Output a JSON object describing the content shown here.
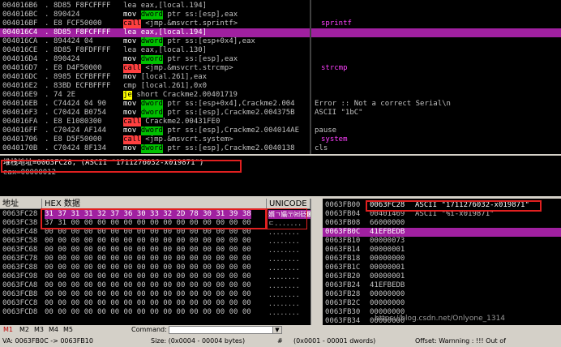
{
  "disasm": [
    {
      "addr": "004016B6",
      "dot": ".",
      "hex": "8D85 F8FCFFFF",
      "mn": "lea",
      "op": "eax,[local.194]",
      "comment": ""
    },
    {
      "addr": "004016BC",
      "dot": ".",
      "hex": "890424",
      "mn": "mov",
      "tag": "dword",
      "op": " ptr ss:[esp],eax",
      "comment": ""
    },
    {
      "addr": "004016BF",
      "dot": ".",
      "hex": "E8 FCF50000",
      "mn": "call",
      "op": "<jmp.&msvcrt.sprintf>",
      "comment": "sprintf"
    },
    {
      "addr": "004016C4",
      "dot": ".",
      "hex": "8D85 F8FCFFFF",
      "mn": "lea",
      "op": "eax,[local.194]",
      "comment": "",
      "selected": true
    },
    {
      "addr": "004016CA",
      "dot": ".",
      "hex": "894424 04",
      "mn": "mov",
      "tag": "dword",
      "op": " ptr ss:[esp+0x4],eax",
      "comment": ""
    },
    {
      "addr": "004016CE",
      "dot": ".",
      "hex": "8D85 F8FDFFFF",
      "mn": "lea",
      "op": "eax,[local.130]",
      "comment": ""
    },
    {
      "addr": "004016D4",
      "dot": ".",
      "hex": "890424",
      "mn": "mov",
      "tag": "dword",
      "op": " ptr ss:[esp],eax",
      "comment": ""
    },
    {
      "addr": "004016D7",
      "dot": ".",
      "hex": "E8 D4F50000",
      "mn": "call",
      "op": "<jmp.&msvcrt.strcmp>",
      "comment": "strcmp"
    },
    {
      "addr": "004016DC",
      "dot": ".",
      "hex": "8985 ECFBFFFF",
      "mn": "mov",
      "op": "[local.261],eax",
      "comment": ""
    },
    {
      "addr": "004016E2",
      "dot": ".",
      "hex": "83BD ECFBFFFF",
      "mn": "cmp",
      "op": "[local.261],0x0",
      "comment": ""
    },
    {
      "addr": "004016E9",
      "dot": ".",
      "hex": "74 2E",
      "mn": "je",
      "op": "short Crackme2.00401719",
      "comment": ""
    },
    {
      "addr": "004016EB",
      "dot": ".",
      "hex": "C74424 04 90",
      "mn": "mov",
      "tag": "dword",
      "op": " ptr ss:[esp+0x4],Crackme2.004",
      "comment": "Error :: Not a correct Serial\\n"
    },
    {
      "addr": "004016F3",
      "dot": ".",
      "hex": "C70424 B0754",
      "mn": "mov",
      "tag": "dword",
      "op": " ptr ss:[esp],Crackme2.004375B",
      "comment": "ASCII \"1bC\""
    },
    {
      "addr": "004016FA",
      "dot": ".",
      "hex": "E8 E1080300",
      "mn": "call",
      "op": "Crackme2.00431FE0",
      "comment": ""
    },
    {
      "addr": "004016FF",
      "dot": ".",
      "hex": "C70424 AF144",
      "mn": "mov",
      "tag": "dword",
      "op": " ptr ss:[esp],Crackme2.004014AE",
      "comment": "pause"
    },
    {
      "addr": "00401706",
      "dot": ".",
      "hex": "E8 D5F50000",
      "mn": "call",
      "op": "<jmp.&msvcrt.system>",
      "comment": "system"
    },
    {
      "addr": "0040170B",
      "dot": ".",
      "hex": "C70424 8F134",
      "mn": "mov",
      "tag": "dword",
      "op": " ptr ss:[esp],Crackme2.0040138",
      "comment": "cls"
    }
  ],
  "info": {
    "line1": "堆栈地址=0063FC28, (ASCII \"1711276032-x019871\")",
    "line2": "eax=00000012"
  },
  "dump": {
    "headers": {
      "addr": "地址",
      "hex": "HEX 数据",
      "unicode": "UNICODE"
    },
    "rows": [
      {
        "addr": "0063FC28",
        "hex": "31 37 31 31 32 37 36 30 33 32 2D 78 30 31 39 38",
        "uni": "㜱ㄱ㜲〶㈳砭㄰㠹"
      },
      {
        "addr": "0063FC38",
        "hex": "37 31 00 00 00 00 00 00 00 00 00 00 00 00 00 00",
        "uni": "ㄷ......."
      },
      {
        "addr": "0063FC48",
        "hex": "00 00 00 00 00 00 00 00 00 00 00 00 00 00 00 00",
        "uni": "........"
      },
      {
        "addr": "0063FC58",
        "hex": "00 00 00 00 00 00 00 00 00 00 00 00 00 00 00 00",
        "uni": "........"
      },
      {
        "addr": "0063FC68",
        "hex": "00 00 00 00 00 00 00 00 00 00 00 00 00 00 00 00",
        "uni": "........"
      },
      {
        "addr": "0063FC78",
        "hex": "00 00 00 00 00 00 00 00 00 00 00 00 00 00 00 00",
        "uni": "........"
      },
      {
        "addr": "0063FC88",
        "hex": "00 00 00 00 00 00 00 00 00 00 00 00 00 00 00 00",
        "uni": "........"
      },
      {
        "addr": "0063FC98",
        "hex": "00 00 00 00 00 00 00 00 00 00 00 00 00 00 00 00",
        "uni": "........"
      },
      {
        "addr": "0063FCA8",
        "hex": "00 00 00 00 00 00 00 00 00 00 00 00 00 00 00 00",
        "uni": "........"
      },
      {
        "addr": "0063FCB8",
        "hex": "00 00 00 00 00 00 00 00 00 00 00 00 00 00 00 00",
        "uni": "........"
      },
      {
        "addr": "0063FCC8",
        "hex": "00 00 00 00 00 00 00 00 00 00 00 00 00 00 00 00",
        "uni": "........"
      },
      {
        "addr": "0063FCD8",
        "hex": "00 00 00 00 00 00 00 00 00 00 00 00 00 00 00 00",
        "uni": "........"
      }
    ]
  },
  "stack": [
    {
      "addr": "0063FB00",
      "val": "0063FC28",
      "comment": "ASCII \"1711276032-x019871\""
    },
    {
      "addr": "0063FB04",
      "val": "00401469",
      "comment": "ASCII \"%i-x019871\""
    },
    {
      "addr": "0063FB08",
      "val": "66000000",
      "comment": ""
    },
    {
      "addr": "0063FB0C",
      "val": "41EFBEDB",
      "comment": "",
      "selected": true
    },
    {
      "addr": "0063FB10",
      "val": "00000073",
      "comment": ""
    },
    {
      "addr": "0063FB14",
      "val": "00000001",
      "comment": ""
    },
    {
      "addr": "0063FB18",
      "val": "00000000",
      "comment": ""
    },
    {
      "addr": "0063FB1C",
      "val": "00000001",
      "comment": ""
    },
    {
      "addr": "0063FB20",
      "val": "00000001",
      "comment": ""
    },
    {
      "addr": "0063FB24",
      "val": "41EFBEDB",
      "comment": ""
    },
    {
      "addr": "0063FB28",
      "val": "00000000",
      "comment": ""
    },
    {
      "addr": "0063FB2C",
      "val": "00000000",
      "comment": ""
    },
    {
      "addr": "0063FB30",
      "val": "00000000",
      "comment": ""
    },
    {
      "addr": "0063FB34",
      "val": "00000000",
      "comment": ""
    },
    {
      "addr": "0063FB38",
      "val": "00000000",
      "comment": ""
    }
  ],
  "tabs": [
    "M1",
    "M2",
    "M3",
    "M4",
    "M5"
  ],
  "command_label": "Command:",
  "watermark": "https://blog.csdn.net/Onlyone_1314",
  "status": {
    "va": "VA: 0063FB0C -> 0063FB10",
    "size": "Size: (0x0004 - 00004 bytes)",
    "hash": "#",
    "count": "(0x0001 - 00001 dwords)",
    "offset": "Offset: Warnning : !!! Out of"
  },
  "colors": {
    "accent": "#a020a0",
    "call": "#ff4040",
    "je": "#ffff00",
    "dword": "#00c000",
    "highlight_box": "#e02020"
  }
}
